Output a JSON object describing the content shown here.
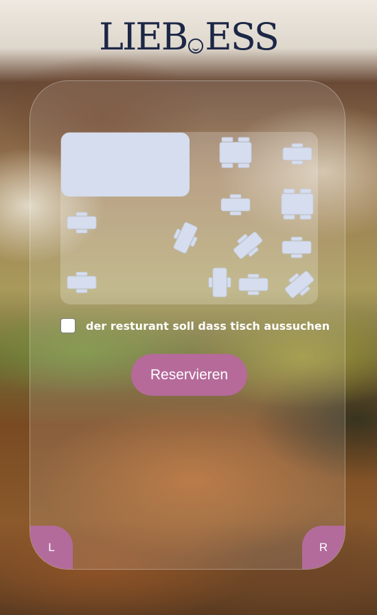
{
  "brand": {
    "logo_left": "LIEB",
    "logo_right": "ESS"
  },
  "colors": {
    "accent": "#b56a9a",
    "logo": "#1c2746",
    "table": "#d5ddee"
  },
  "floor_plan": {
    "tables": [
      {
        "id": "t1"
      },
      {
        "id": "t2"
      },
      {
        "id": "t3"
      },
      {
        "id": "t4"
      },
      {
        "id": "t5"
      },
      {
        "id": "t6"
      },
      {
        "id": "t7"
      },
      {
        "id": "t8"
      },
      {
        "id": "t9"
      },
      {
        "id": "t10"
      },
      {
        "id": "t11"
      },
      {
        "id": "t12"
      },
      {
        "id": "t13"
      },
      {
        "id": "t14"
      }
    ]
  },
  "form": {
    "checkbox_label": "der resturant soll dass tisch aussuchen",
    "checkbox_checked": false,
    "submit_label": "Reservieren"
  },
  "nav": {
    "left_label": "L",
    "right_label": "R"
  }
}
